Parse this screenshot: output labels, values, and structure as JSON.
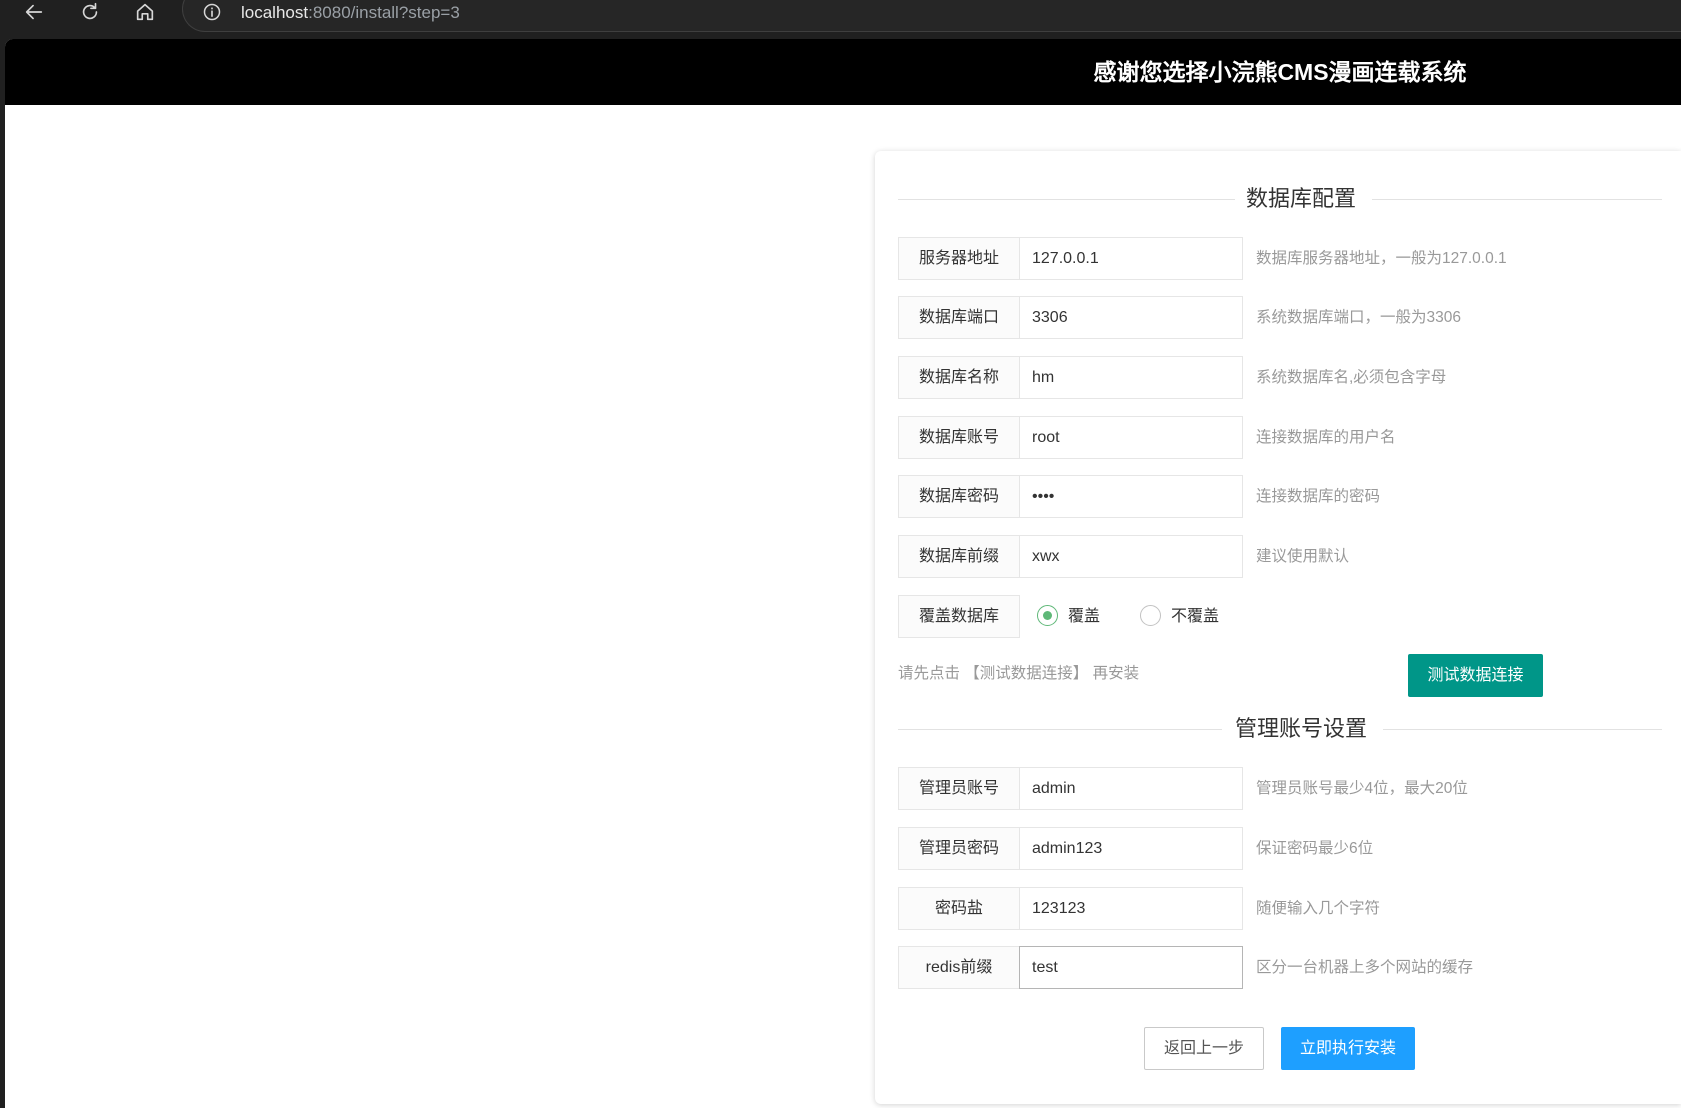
{
  "browser": {
    "url_host": "localhost",
    "url_rest": ":8080/install?step=3",
    "icons": {
      "back": "back-arrow-icon",
      "refresh": "refresh-icon",
      "home": "home-icon",
      "info": "info-icon"
    }
  },
  "header": {
    "title": "感谢您选择小浣熊CMS漫画连载系统"
  },
  "db": {
    "title": "数据库配置",
    "fields": [
      {
        "label": "服务器地址",
        "value": "127.0.0.1",
        "hint": "数据库服务器地址，一般为127.0.0.1"
      },
      {
        "label": "数据库端口",
        "value": "3306",
        "hint": "系统数据库端口，一般为3306"
      },
      {
        "label": "数据库名称",
        "value": "hm",
        "hint": "系统数据库名,必须包含字母"
      },
      {
        "label": "数据库账号",
        "value": "root",
        "hint": "连接数据库的用户名"
      },
      {
        "label": "数据库密码",
        "value": "••••",
        "hint": "连接数据库的密码"
      },
      {
        "label": "数据库前缀",
        "value": "xwx",
        "hint": "建议使用默认"
      }
    ],
    "overwrite": {
      "label": "覆盖数据库",
      "options": [
        {
          "label": "覆盖",
          "checked": true
        },
        {
          "label": "不覆盖",
          "checked": false
        }
      ]
    },
    "notice": "请先点击 【测试数据连接】 再安装",
    "test_button": "测试数据连接"
  },
  "admin": {
    "title": "管理账号设置",
    "fields": [
      {
        "label": "管理员账号",
        "value": "admin",
        "hint": "管理员账号最少4位，最大20位"
      },
      {
        "label": "管理员密码",
        "value": "admin123",
        "hint": "保证密码最少6位"
      },
      {
        "label": "密码盐",
        "value": "123123",
        "hint": "随便输入几个字符"
      },
      {
        "label": "redis前缀",
        "value": "test",
        "hint": "区分一台机器上多个网站的缓存"
      }
    ]
  },
  "actions": {
    "back": "返回上一步",
    "install": "立即执行安装"
  },
  "colors": {
    "header_bg": "#000000",
    "radio_checked": "#5FB878",
    "test_button": "#009688",
    "install_button": "#1E9FFF",
    "hint_text": "#999999"
  }
}
